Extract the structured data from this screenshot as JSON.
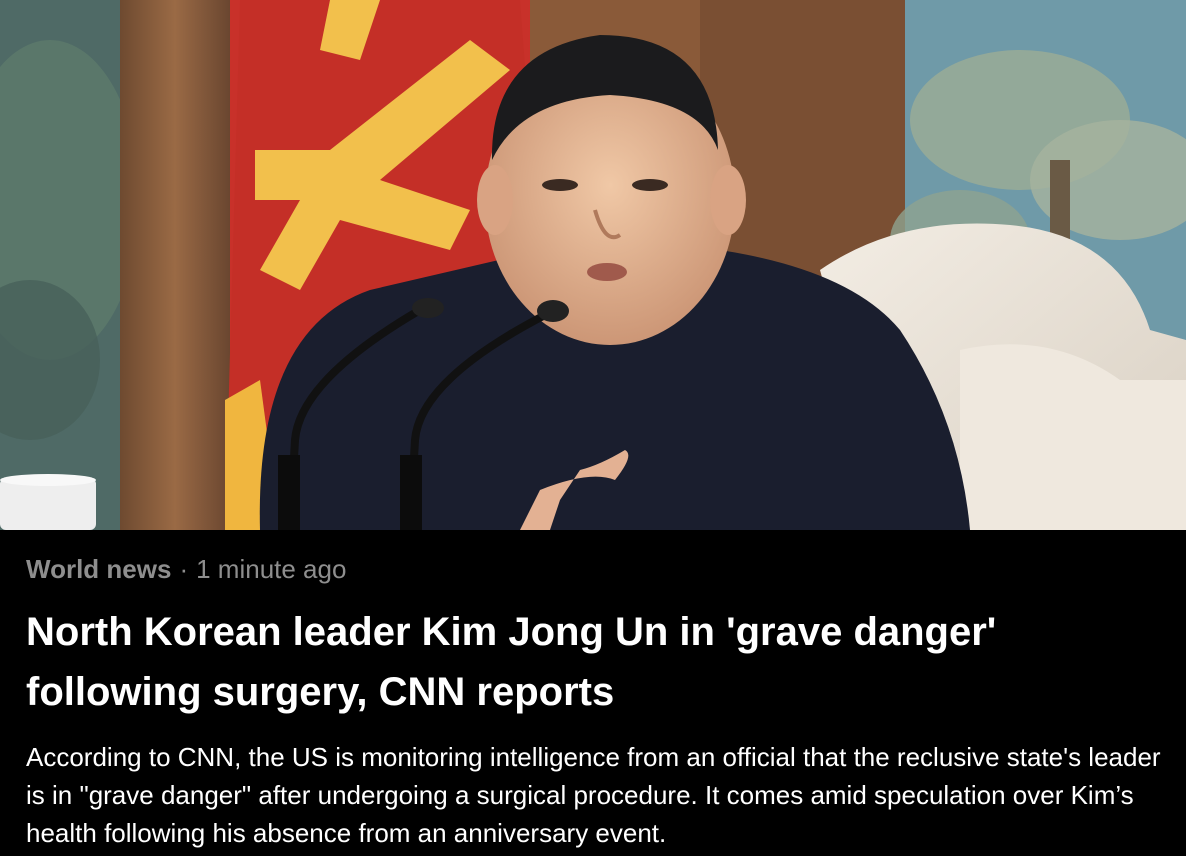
{
  "article": {
    "category": "World news",
    "separator": "·",
    "timestamp": "1 minute ago",
    "headline": "North Korean leader Kim Jong Un in 'grave danger' following surgery, CNN reports",
    "summary": "According to CNN, the US is monitoring intelligence from an official that the reclusive state's leader is in \"grave danger\" after undergoing a surgical procedure. It comes amid speculation over Kim’s health following his absence from an anniversary event."
  },
  "colors": {
    "background": "#000000",
    "headline": "#ffffff",
    "meta": "#8e8e8e",
    "summary": "#ffffff"
  }
}
